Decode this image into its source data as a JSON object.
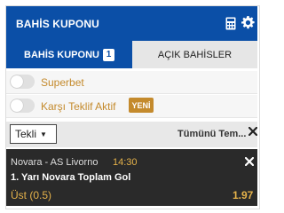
{
  "header": {
    "title": "BAHİS KUPONU",
    "calculator_icon": "calculator-icon",
    "settings_icon": "gear-icon"
  },
  "tabs": [
    {
      "label": "BAHİS KUPONU",
      "count": "1",
      "active": true
    },
    {
      "label": "AÇIK BAHİSLER",
      "active": false
    }
  ],
  "options": {
    "superbet": {
      "label": "Superbet",
      "enabled": false
    },
    "karsi_teklif": {
      "label": "Karşı Teklif Aktif",
      "enabled": false,
      "badge": "YENİ"
    }
  },
  "bet_type": {
    "selected": "Tekli",
    "caret": "▼",
    "clear_label": "Tümünü Tem..."
  },
  "bets": [
    {
      "match": "Novara - AS Livorno",
      "time": "14:30",
      "market": "1. Yarı Novara Toplam Gol",
      "selection": "Üst (0.5)",
      "odd": "1.97"
    }
  ],
  "colors": {
    "brand_blue": "#0b4fa7",
    "gold": "#c48a2c",
    "bet_bg": "#2a2a2a",
    "bet_accent": "#e5b24a"
  }
}
